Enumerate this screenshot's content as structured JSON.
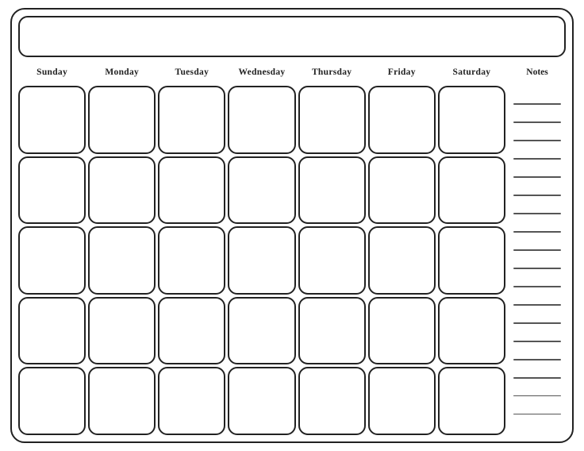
{
  "calendar": {
    "title": "",
    "days": [
      "Sunday",
      "Monday",
      "Tuesday",
      "Wednesday",
      "Thursday",
      "Friday",
      "Saturday"
    ],
    "notes_label": "Notes",
    "rows": 5,
    "notes_lines": 18
  }
}
